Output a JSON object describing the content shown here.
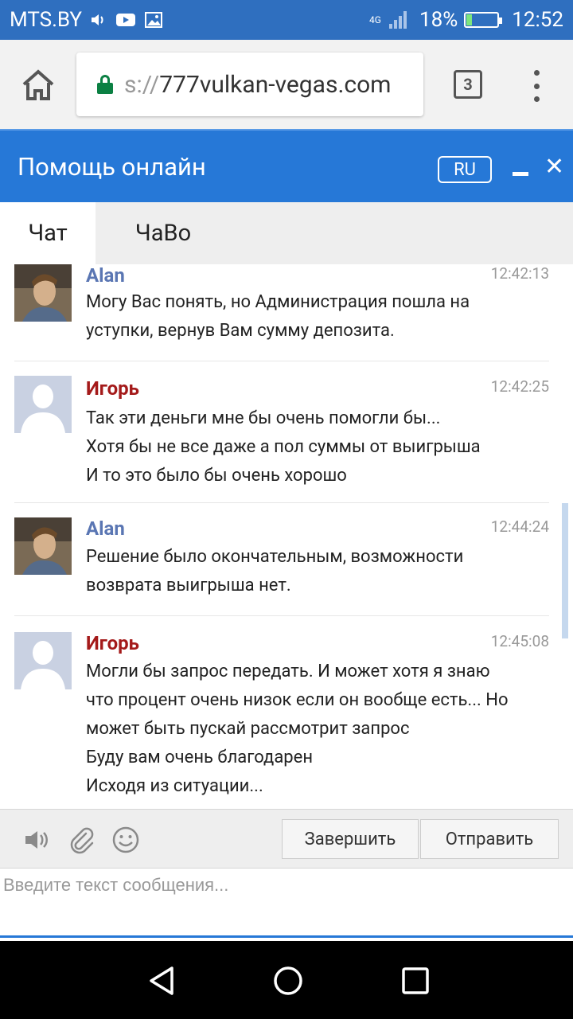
{
  "status_bar": {
    "carrier": "MTS.BY",
    "network": "4G",
    "battery": "18%",
    "time": "12:52"
  },
  "browser": {
    "url_scheme": "s://",
    "url_host": "777vulkan-vegas.com",
    "tab_count": "3"
  },
  "chat": {
    "title": "Помощь онлайн",
    "lang": "RU",
    "tabs": [
      {
        "label": "Чат"
      },
      {
        "label": "ЧаВо"
      }
    ],
    "messages": [
      {
        "author": "Alan",
        "role": "agent",
        "time": "12:42:13",
        "lines": [
          "Могу Вас понять, но Администрация пошла на",
          "уступки, вернув Вам сумму депозита."
        ]
      },
      {
        "author": "Игорь",
        "role": "user",
        "time": "12:42:25",
        "lines": [
          "Так эти деньги мне бы очень помогли бы...",
          "Хотя бы не все даже а пол суммы от выигрыша",
          "И то это было бы очень хорошо"
        ]
      },
      {
        "author": "Alan",
        "role": "agent",
        "time": "12:44:24",
        "lines": [
          "Решение было окончательным, возможности",
          "возврата выигрыша нет."
        ]
      },
      {
        "author": "Игорь",
        "role": "user",
        "time": "12:45:08",
        "lines": [
          "Могли бы запрос передать. И может хотя я знаю",
          "что процент очень низок если он вообще есть... Но",
          "может быть пускай рассмотрит запрос",
          "Буду вам очень благодарен",
          "Исходя из ситуации..."
        ]
      }
    ],
    "toolbar": {
      "finish_label": "Завершить",
      "send_label": "Отправить"
    },
    "input_placeholder": "Введите текст сообщения..."
  }
}
